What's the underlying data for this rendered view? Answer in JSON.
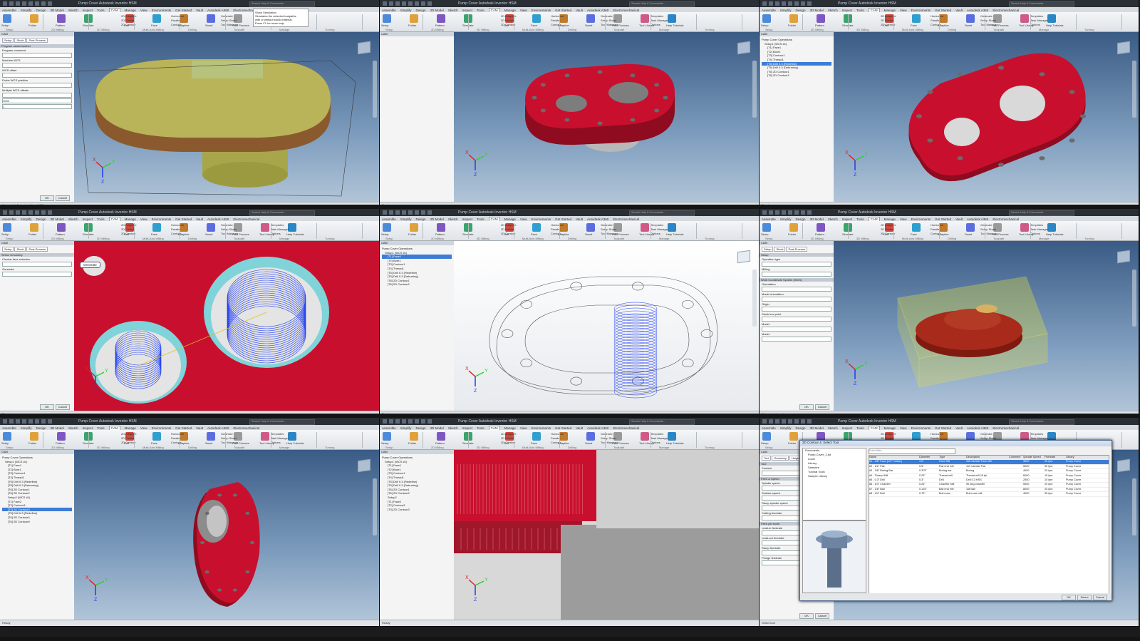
{
  "app": {
    "title": "Pump Cover Autodesk Inventor HSM",
    "search_placeholder": "Search Help & Commands...",
    "menus": [
      "Assemble",
      "Simplify",
      "Design",
      "3D Model",
      "Sketch",
      "Inspect",
      "Tools",
      "CAM",
      "Manage",
      "View",
      "Environments",
      "Get Started",
      "Vault",
      "Autodesk A360",
      "Electromechanical"
    ],
    "active_menu": "CAM"
  },
  "ribbon": {
    "groups": [
      "Setup",
      "2D Milling",
      "3D Milling",
      "Multi-Axis Milling",
      "Drilling",
      "Toolpath",
      "Manage",
      "Turning"
    ],
    "buttons": [
      {
        "label": "Setup",
        "icon": "setup-icon"
      },
      {
        "label": "Folder",
        "icon": "folder-icon"
      },
      {
        "label": "Pattern",
        "icon": "pattern-icon"
      },
      {
        "label": "Simulate",
        "icon": "simulate-icon"
      },
      {
        "label": "Drill",
        "icon": "drill-icon"
      },
      {
        "label": "Face",
        "icon": "face-icon"
      },
      {
        "label": "Adaptive",
        "icon": "adaptive-icon"
      },
      {
        "label": "Swarf",
        "icon": "swarf-icon"
      },
      {
        "label": "Post Process",
        "icon": "post-icon"
      },
      {
        "label": "Tool Library",
        "icon": "tool-library-icon"
      },
      {
        "label": "Help Tutorials",
        "icon": "help-icon"
      }
    ],
    "small_items": [
      "2D Adaptive",
      "2D Pocket",
      "2D Contour",
      "Horizontal",
      "Parallel",
      "Contour",
      "Generate",
      "Setup Sheet",
      "Tool Manager",
      "Templates",
      "Task Manager",
      "Options"
    ]
  },
  "tooltip": {
    "title": "Show Simulation",
    "lines": [
      "Simulates the selected toolpaths",
      "with or without stock material.",
      "Press F1 for more help"
    ]
  },
  "panels": [
    {
      "id": "p1",
      "browser": "form",
      "browser_title": "CAM",
      "tabs": [
        "Setup",
        "Stock",
        "Post Process"
      ],
      "labels": [
        "Program name/number",
        "Program comment",
        "Machine WCS",
        "WCS offset",
        "Probe WCS position",
        "Multiple WCS offsets"
      ],
      "values": [
        "1001",
        "1"
      ],
      "buttons": [
        "OK",
        "Cancel"
      ],
      "status": "Select Unit Setup to define WCS"
    },
    {
      "id": "p2",
      "browser": "tree",
      "browser_title": "CAM",
      "tree": [],
      "status": "Ready"
    },
    {
      "id": "p3",
      "browser": "tree",
      "browser_title": "CAM",
      "tree": [
        "Pump Cover Operations",
        "Setup1 (WCS #1)",
        "[T1] Face1",
        "[T2] Bore1",
        "[T3] Contour1",
        "[T4] Thread1",
        "[T5] Drill 0.3 (Redefine)",
        "[T5] Drill 0.3 (Deburring)",
        "[T6] 2D Contour1",
        "[T6] 2D Contour2"
      ],
      "selected": 6,
      "status": "Ready"
    },
    {
      "id": "p4",
      "browser": "form",
      "browser_title": "CAM",
      "tabs": [
        "Setup",
        "Stock",
        "Post Process"
      ],
      "labels": [
        "Select Geometry",
        "Circular face selection",
        "Generate"
      ],
      "values": [],
      "buttons": [
        "OK",
        "Cancel"
      ],
      "callout": "Generate",
      "status": "Ready"
    },
    {
      "id": "p5",
      "browser": "tree",
      "browser_title": "CAM",
      "tree": [
        "Pump Cover Operations",
        "Setup1 (WCS #1)",
        "[T1] Face1",
        "[T2] Bore1",
        "[T3] Contour1",
        "[T4] Thread1",
        "[T5] Drill 0.3 (Redefine)",
        "[T5] Drill 0.3 (Deburring)",
        "[T6] 2D Contour1",
        "[T6] 2D Contour2"
      ],
      "selected": 2,
      "status": "Ready"
    },
    {
      "id": "p6",
      "browser": "form",
      "browser_title": "CAM",
      "tabs": [
        "Setup",
        "Stock",
        "Post Process"
      ],
      "labels": [
        "Setup",
        "Operation type",
        "Milling",
        "Work Coordinate System (WCS)",
        "Orientation",
        "Model orientation",
        "Origin",
        "Stock box point",
        "Model",
        "Model"
      ],
      "values": [],
      "buttons": [
        "OK",
        "Cancel"
      ],
      "status": "Select stock point"
    },
    {
      "id": "p7",
      "browser": "tree",
      "browser_title": "CAM",
      "tree": [
        "Pump Cover Operations",
        "Setup1 (WCS #1)",
        "[T1] Face1",
        "[T2] Bore1",
        "[T3] Contour1",
        "[T4] Thread1",
        "[T5] Drill 0.3 (Redefine)",
        "[T5] Drill 0.3 (Deburring)",
        "[T6] 2D Contour1",
        "[T6] 2D Contour2",
        "Setup2 (WCS #1)",
        "[T1] Face2",
        "[T2] Contour3",
        "[T3] 2D Contour3",
        "[T5] Drill 0.3 (Redefine)",
        "[T6] 2D Contour4",
        "[T6] 2D Contour5"
      ],
      "selected": 13,
      "status": "Ready"
    },
    {
      "id": "p8",
      "browser": "tree",
      "browser_title": "CAM",
      "tree": [
        "Pump Cover Operations",
        "Setup1 (WCS #1)",
        "[T1] Face1",
        "[T2] Bore1",
        "[T3] Contour1",
        "[T4] Thread1",
        "[T5] Drill 0.3 (Redefine)",
        "[T5] Drill 0.3 (Deburring)",
        "[T6] 2D Contour1",
        "[T6] 2D Contour2",
        "Setup2",
        "[T1] Face2",
        "[T2] Contour3",
        "[T3] 2D Contour3"
      ],
      "selected": -1,
      "status": "Ready"
    },
    {
      "id": "p9",
      "browser": "form",
      "browser_title": "CAM",
      "tabs": [
        "Tool",
        "Geometry",
        "Heights"
      ],
      "labels": [
        "Tool",
        "Coolant",
        "Feed & Speed",
        "Spindle speed",
        "Surface speed",
        "Ramp spindle speed",
        "Cutting feedrate",
        "Feed per tooth",
        "Lead-in feedrate",
        "Lead-out feedrate",
        "Ramp feedrate",
        "Plunge feedrate"
      ],
      "values": [],
      "buttons": [
        "OK",
        "Cancel"
      ],
      "status": "Select tool"
    }
  ],
  "tool_dialog": {
    "title": "2D Contour 4: Select Tool",
    "library_tree": [
      "Documents",
      "Pump Cover_2.ipt",
      "Local",
      "Library",
      "Samples",
      "Tutorial Tools",
      "Sample Library"
    ],
    "columns": [
      "Name",
      "Diameter",
      "Type",
      "Description",
      "Comment",
      "Spindle Speed",
      "Feedrate",
      "Library"
    ],
    "rows": [
      [
        "#1 - 3/8\" Face (1/2\" Holder)",
        "1.0\"",
        "Face Mill",
        "3/8 Carbide Face Mill",
        "",
        "3000",
        "25 ipm",
        "Pump Cover"
      ],
      [
        "#2 - 1/2\" Flat",
        "0.5\"",
        "Flat end mill",
        "1/2 Carbide Flat",
        "",
        "5000",
        "30 ipm",
        "Pump Cover"
      ],
      [
        "#3 - 3/8\" Boring Bar",
        "0.375\"",
        "Boring bar",
        "Boring",
        "",
        "4000",
        "20 ipm",
        "Pump Cover"
      ],
      [
        "#4 - Thread Mill",
        "0.25\"",
        "Thread mill",
        "Thread mill 16 tpi",
        "",
        "6000",
        "15 ipm",
        "Pump Cover"
      ],
      [
        "#5 - 0.3\" Drill",
        "0.3\"",
        "Drill",
        "Drill 0.3 HSS",
        "",
        "2500",
        "10 ipm",
        "Pump Cover"
      ],
      [
        "#6 - 1/4\" Chamfer",
        "0.25\"",
        "Chamfer Mill",
        "90 deg chamfer",
        "",
        "5000",
        "20 ipm",
        "Pump Cover"
      ],
      [
        "#7 - 1/8\" Ball",
        "0.125\"",
        "Ball end mill",
        "1/8 Ball",
        "",
        "8000",
        "25 ipm",
        "Pump Cover"
      ],
      [
        "#8 - 3/4\" Bull",
        "0.75\"",
        "Bull nose",
        "Bull nose mill",
        "",
        "4000",
        "35 ipm",
        "Pump Cover"
      ]
    ],
    "selected_row": 0,
    "buttons": [
      "OK",
      "Select",
      "Cancel"
    ],
    "filter_placeholder": "Enter filter..."
  },
  "viewport": {
    "axis_labels": {
      "x": "X",
      "y": "Y",
      "z": "Z"
    }
  },
  "colors": {
    "part_red": "#c8102e",
    "part_tan": "#b9b35a",
    "toolpath_blue": "#1f3cf0",
    "stock_yellow": "#e4e03c",
    "ribbon": "#e6e9ed"
  }
}
